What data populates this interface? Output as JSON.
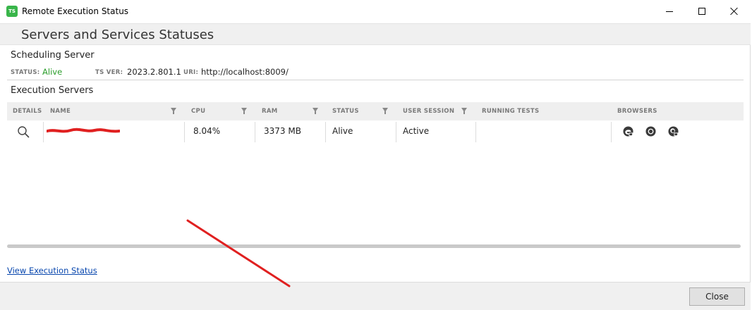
{
  "window": {
    "app_icon_text": "TS",
    "title": "Remote Execution Status",
    "icons": [
      "app-icon",
      "minimize-icon",
      "maximize-icon",
      "close-icon"
    ]
  },
  "header": {
    "title": "Servers and Services Statuses"
  },
  "scheduling_server": {
    "title": "Scheduling Server",
    "status_label": "STATUS:",
    "status_value": "Alive",
    "ts_ver_label": "TS VER:",
    "ts_ver_value": "2023.2.801.1",
    "uri_label": "URI:",
    "uri_value": "http://localhost:8009/"
  },
  "execution_servers": {
    "title": "Execution Servers",
    "columns": [
      "DETAILS",
      "NAME",
      "CPU",
      "RAM",
      "STATUS",
      "USER SESSION",
      "RUNNING TESTS",
      "BROWSERS"
    ],
    "rows": [
      {
        "details_icon": "magnifier-icon",
        "name": "[redacted]",
        "cpu": "8.04%",
        "ram": "3373 MB",
        "status": "Alive",
        "user_session": "Active",
        "running_tests": "",
        "browsers": [
          "edge-icon",
          "chrome-icon",
          "firefox-icon"
        ]
      }
    ]
  },
  "links": {
    "view_execution_status": "View Execution Status"
  },
  "footer": {
    "close_label": "Close"
  },
  "colors": {
    "status_alive": "#2a9d2a",
    "link": "#0645ad",
    "annotation_arrow": "#e02020",
    "app_icon": "#39b54a"
  }
}
